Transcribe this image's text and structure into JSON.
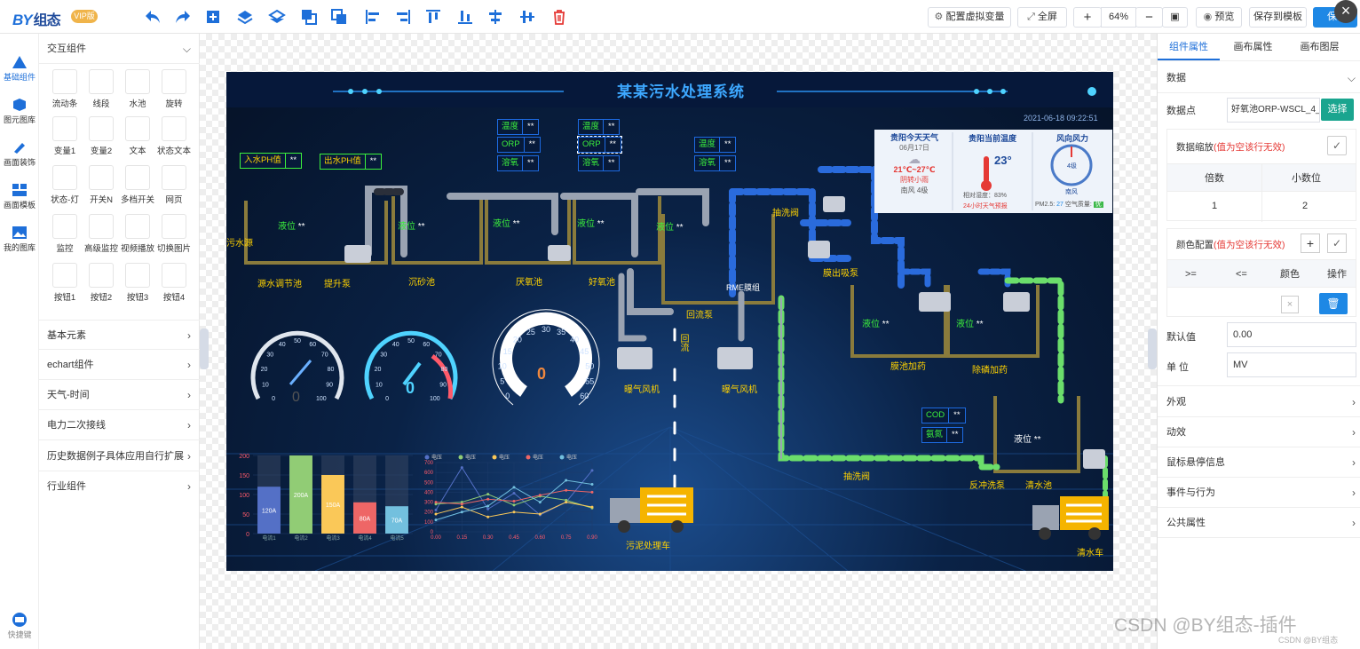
{
  "app": {
    "logo": "BY",
    "logo_suffix": "组态",
    "vip_badge": "VIP版"
  },
  "toolbar": {
    "virtual_var": "配置虚拟变量",
    "fullscreen": "全屏",
    "zoom": "64%",
    "preview": "预览",
    "save_template": "保存到模板",
    "save": "保存"
  },
  "rail": [
    {
      "label": "基础组件",
      "icon": "triangle-icon"
    },
    {
      "label": "图元图库",
      "icon": "cube-icon"
    },
    {
      "label": "画面装饰",
      "icon": "brush-icon"
    },
    {
      "label": "画面模板",
      "icon": "template-icon"
    },
    {
      "label": "我的图库",
      "icon": "image-icon"
    },
    {
      "label": "快捷键",
      "icon": "keyboard-icon"
    }
  ],
  "panel": {
    "interactive_title": "交互组件",
    "components": [
      {
        "label": "流动条"
      },
      {
        "label": "线段"
      },
      {
        "label": "水池"
      },
      {
        "label": "旋转"
      },
      {
        "label": "变量1"
      },
      {
        "label": "变量2"
      },
      {
        "label": "文本"
      },
      {
        "label": "状态文本"
      },
      {
        "label": "状态-灯"
      },
      {
        "label": "开关N"
      },
      {
        "label": "多档开关"
      },
      {
        "label": "网页"
      },
      {
        "label": "监控"
      },
      {
        "label": "高级监控"
      },
      {
        "label": "视频播放"
      },
      {
        "label": "切换图片"
      },
      {
        "label": "按钮1"
      },
      {
        "label": "按钮2"
      },
      {
        "label": "按钮3"
      },
      {
        "label": "按钮4"
      }
    ],
    "sections": [
      {
        "label": "基本元素"
      },
      {
        "label": "echart组件"
      },
      {
        "label": "天气-时间"
      },
      {
        "label": "电力二次接线"
      },
      {
        "label": "历史数据例子具体应用自行扩展"
      },
      {
        "label": "行业组件"
      }
    ]
  },
  "scada": {
    "title": "某某污水处理系统",
    "datetime": "2021-06-18  09:22:51",
    "labels": {
      "inlet_ph": "入水PH值",
      "outlet_ph": "出水PH值",
      "stars": "**",
      "temperature": "温度",
      "orp": "ORP",
      "oxygen": "溶氧",
      "level": "液位",
      "sewage_source": "污水源",
      "tank_adjust": "源水调节池",
      "lift_pump": "提升泵",
      "sand_tank": "沉砂池",
      "anaerobic": "厌氧池",
      "aerobic": "好氧池",
      "return_pump": "回流泵",
      "rme": "RME膜组",
      "backwash_valve": "抽洗阀",
      "membrane_pump": "膜出吸泵",
      "fan1": "曝气风机",
      "fan2": "曝气风机",
      "membrane_dosing": "膜池加药",
      "phos_dosing": "除磷加药",
      "cod": "COD",
      "ammonia": "氨氮",
      "wash_valve": "抽洗阀",
      "reverse_pump": "反冲洗泵",
      "clear_tank": "清水池",
      "sludge_truck": "污泥处理车",
      "water_truck": "清水车",
      "side_label": "回流"
    },
    "weather": {
      "title": "贵阳今天天气",
      "date": "06月17日",
      "temp": "21℃~27℃",
      "desc": "阴转小雨",
      "wind": "南风 4级",
      "current_title": "贵阳当前温度",
      "current": "23°",
      "humidity": "相对湿度：83%",
      "forecast": "24小时天气预报",
      "wind_title": "风向风力",
      "wind_dir": "南风",
      "wind_level": "4级",
      "pm": "PM2.5:",
      "pm_val": "27",
      "air": "空气质量:",
      "air_q": "优"
    },
    "gauges": [
      {
        "value": "0",
        "ticks": [
          "0",
          "10",
          "20",
          "30",
          "40",
          "50",
          "60",
          "70",
          "80",
          "90",
          "100"
        ]
      },
      {
        "value": "0",
        "ticks": [
          "0",
          "10",
          "20",
          "30",
          "40",
          "50",
          "60",
          "70",
          "80",
          "90",
          "100"
        ]
      },
      {
        "value": "0",
        "ticks": [
          "0",
          "5",
          "10",
          "15",
          "20",
          "25",
          "30",
          "35",
          "40",
          "45",
          "50",
          "55",
          "60"
        ]
      }
    ]
  },
  "chart_data": [
    {
      "type": "bar",
      "categories": [
        "电流1",
        "电流2",
        "电流3",
        "电流4",
        "电流5"
      ],
      "values": [
        120,
        200,
        150,
        80,
        70
      ],
      "data_labels": [
        "120A",
        "200A",
        "150A",
        "80A",
        "70A"
      ],
      "colors": [
        "#5470c6",
        "#91cc75",
        "#fac858",
        "#ee6666",
        "#73c0de"
      ],
      "yticks": [
        "0",
        "50",
        "100",
        "150",
        "200"
      ],
      "ylim": [
        0,
        200
      ]
    },
    {
      "type": "line",
      "x": [
        "0.00",
        "0.15",
        "0.30",
        "0.45",
        "0.60",
        "0.75",
        "0.90"
      ],
      "ylim": [
        0,
        700
      ],
      "yticks": [
        "0",
        "100",
        "200",
        "300",
        "400",
        "500",
        "600",
        "700"
      ],
      "series": [
        {
          "name": "电压",
          "color": "#5470c6",
          "values": [
            220,
            650,
            230,
            390,
            170,
            300,
            620
          ]
        },
        {
          "name": "电压",
          "color": "#91cc75",
          "values": [
            280,
            300,
            380,
            270,
            360,
            320,
            240
          ]
        },
        {
          "name": "电压",
          "color": "#fac858",
          "values": [
            180,
            250,
            150,
            200,
            180,
            300,
            250
          ]
        },
        {
          "name": "电压",
          "color": "#ee6666",
          "values": [
            300,
            280,
            330,
            310,
            370,
            420,
            400
          ]
        },
        {
          "name": "电压",
          "color": "#73c0de",
          "values": [
            120,
            200,
            260,
            450,
            300,
            520,
            480
          ]
        }
      ]
    }
  ],
  "props": {
    "tabs": [
      "组件属性",
      "画布属性",
      "画布图层"
    ],
    "data_section": "数据",
    "datapoint_label": "数据点",
    "datapoint_value": "好氧池ORP-WSCL_4_",
    "select_btn": "选择",
    "scale_label": "数据缩放",
    "scale_warning": "(值为空该行无效)",
    "multiplier_h": "倍数",
    "decimals_h": "小数位",
    "multiplier": "1",
    "decimals": "2",
    "color_label": "颜色配置",
    "color_warning": "(值为空该行无效)",
    "ge": ">=",
    "le": "<=",
    "color_h": "颜色",
    "op_h": "操作",
    "default_label": "默认值",
    "default_value": "0.00",
    "unit_label": "单 位",
    "unit_value": "MV",
    "collapsibles": [
      "外观",
      "动效",
      "鼠标悬停信息",
      "事件与行为",
      "公共属性"
    ]
  },
  "watermark": "CSDN @BY组态-插件",
  "watermark_small": "CSDN @BY组态"
}
